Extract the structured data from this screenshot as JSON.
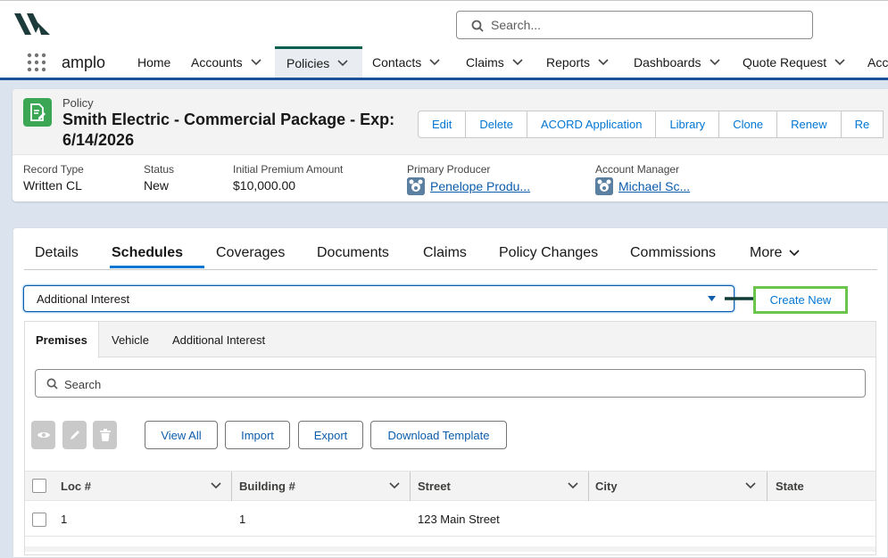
{
  "header": {
    "logo_name": "amplo-logo",
    "search_placeholder": "Search..."
  },
  "nav": {
    "app_name": "amplo",
    "items": [
      {
        "label": "Home",
        "has_menu": false
      },
      {
        "label": "Accounts",
        "has_menu": true
      },
      {
        "label": "Policies",
        "has_menu": true,
        "active": true
      },
      {
        "label": "Contacts",
        "has_menu": true
      },
      {
        "label": "Claims",
        "has_menu": true
      },
      {
        "label": "Reports",
        "has_menu": true
      },
      {
        "label": "Dashboards",
        "has_menu": true
      },
      {
        "label": "Quote Request",
        "has_menu": true
      },
      {
        "label": "Acc",
        "has_menu": false
      }
    ]
  },
  "record": {
    "object_type": "Policy",
    "name": "Smith Electric - Commercial Package - Exp: 6/14/2026",
    "actions": [
      "Edit",
      "Delete",
      "ACORD Application",
      "Library",
      "Clone",
      "Renew",
      "Re"
    ],
    "fields": [
      {
        "label": "Record Type",
        "value": "Written CL"
      },
      {
        "label": "Status",
        "value": "New"
      },
      {
        "label": "Initial Premium Amount",
        "value": "$10,000.00"
      },
      {
        "label": "Primary Producer",
        "value": "Penelope Produ..."
      },
      {
        "label": "Account Manager",
        "value": "Michael Sc..."
      }
    ]
  },
  "tabs": {
    "items": [
      "Details",
      "Schedules",
      "Coverages",
      "Documents",
      "Claims",
      "Policy Changes",
      "Commissions",
      "More"
    ],
    "active": "Schedules"
  },
  "schedule_picker": {
    "selected": "Additional Interest"
  },
  "create_new_label": "Create New",
  "subtabs": {
    "items": [
      "Premises",
      "Vehicle",
      "Additional Interest"
    ],
    "active": "Premises"
  },
  "table_search_placeholder": "Search",
  "toolbar": {
    "icons": [
      "eye-icon",
      "pencil-icon",
      "trash-icon"
    ],
    "buttons": [
      "View All",
      "Import",
      "Export",
      "Download Template"
    ]
  },
  "table": {
    "columns": [
      "Loc #",
      "Building #",
      "Street",
      "City",
      "State"
    ],
    "rows": [
      [
        "1",
        "1",
        "123 Main Street",
        "",
        ""
      ]
    ]
  },
  "colors": {
    "nav_active_accent": "#0b5f4e",
    "link_blue": "#0176d3",
    "object_icon_green": "#3ba755",
    "highlight_green": "#6bc44b"
  }
}
